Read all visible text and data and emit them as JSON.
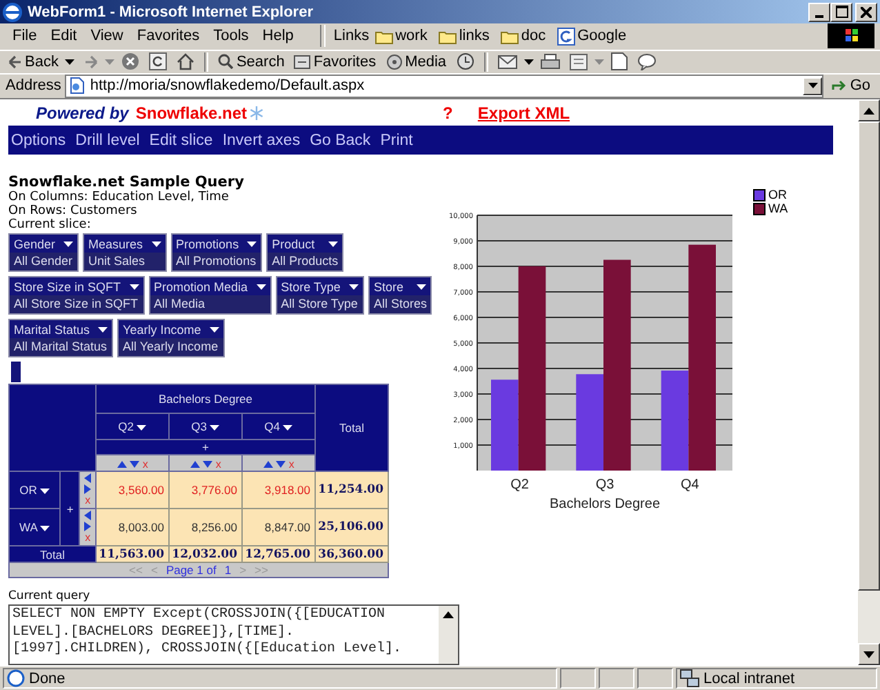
{
  "window": {
    "title": "WebForm1 - Microsoft Internet Explorer"
  },
  "menu": [
    "File",
    "Edit",
    "View",
    "Favorites",
    "Tools",
    "Help"
  ],
  "links": {
    "label": "Links",
    "items": [
      "work",
      "links",
      "doc",
      "Google"
    ]
  },
  "toolbar_labels": [
    "Back",
    "Search",
    "Favorites",
    "Media"
  ],
  "address": {
    "label": "Address",
    "value": "http://moria/snowflakedemo/Default.aspx",
    "go": "Go"
  },
  "brand": {
    "prefix": "Powered by",
    "name": "Snowflake.net"
  },
  "top_links": [
    "?",
    "Export XML"
  ],
  "nav": [
    "Options",
    "Drill level",
    "Edit slice",
    "Invert axes",
    "Go Back",
    "Print"
  ],
  "heading": "Snowflake.net Sample Query",
  "info": [
    "On Columns: Education Level, Time",
    "On Rows: Customers",
    "Current slice:"
  ],
  "slicers": [
    [
      {
        "name": "Gender",
        "value": "All Gender"
      },
      {
        "name": "Measures",
        "value": "Unit Sales"
      },
      {
        "name": "Promotions",
        "value": "All Promotions"
      },
      {
        "name": "Product",
        "value": "All Products"
      }
    ],
    [
      {
        "name": "Store Size in SQFT",
        "value": "All Store Size in SQFT"
      },
      {
        "name": "Promotion Media",
        "value": "All Media"
      },
      {
        "name": "Store Type",
        "value": "All Store Type"
      },
      {
        "name": "Store",
        "value": "All Stores"
      }
    ],
    [
      {
        "name": "Marital Status",
        "value": "All Marital Status"
      },
      {
        "name": "Yearly Income",
        "value": "All Yearly Income"
      }
    ]
  ],
  "pivot": {
    "column_group": "Bachelors Degree",
    "column_total_label": "Total",
    "column_expand": "+",
    "row_expand": "+",
    "row_total_label": "Total",
    "columns": [
      {
        "label": "Q2",
        "remove": "x"
      },
      {
        "label": "Q3",
        "remove": "x"
      },
      {
        "label": "Q4",
        "remove": "x"
      }
    ],
    "rows": [
      {
        "name": "OR",
        "remove": "x",
        "highlighted": true,
        "cells": [
          "3,560.00",
          "3,776.00",
          "3,918.00"
        ],
        "total": "11,254.00"
      },
      {
        "name": "WA",
        "remove": "x",
        "highlighted": false,
        "cells": [
          "8,003.00",
          "8,256.00",
          "8,847.00"
        ],
        "total": "25,106.00"
      }
    ],
    "totals": [
      "11,563.00",
      "12,032.00",
      "12,765.00"
    ],
    "grand_total": "36,360.00",
    "pager": [
      {
        "text": "<<",
        "disabled": true
      },
      {
        "text": "<",
        "disabled": true
      },
      {
        "text": "Page 1 of",
        "disabled": false
      },
      {
        "text": "1",
        "disabled": false
      },
      {
        "text": ">",
        "disabled": true
      },
      {
        "text": ">>",
        "disabled": true
      }
    ]
  },
  "chart": {
    "chart_data": {
      "type": "bar",
      "grid": true,
      "xlabel": "Bachelors Degree",
      "categories": [
        "Q2",
        "Q3",
        "Q4"
      ],
      "series": [
        {
          "name": "OR",
          "color": "#6a3ae0",
          "values": [
            3560,
            3776,
            3918
          ]
        },
        {
          "name": "WA",
          "color": "#7a1038",
          "values": [
            8003,
            8256,
            8847
          ]
        }
      ],
      "ylim": [
        0,
        10000
      ],
      "yticks": [
        {
          "value": 1000,
          "label": "1,000"
        },
        {
          "value": 2000,
          "label": "2,000"
        },
        {
          "value": 3000,
          "label": "3,000"
        },
        {
          "value": 4000,
          "label": "4,000"
        },
        {
          "value": 5000,
          "label": "5,000"
        },
        {
          "value": 6000,
          "label": "6,000"
        },
        {
          "value": 7000,
          "label": "7,000"
        },
        {
          "value": 8000,
          "label": "8,000"
        },
        {
          "value": 9000,
          "label": "9,000"
        },
        {
          "value": 10000,
          "label": "10,000"
        }
      ]
    }
  },
  "query": {
    "label": "Current query",
    "lines": [
      "SELECT NON EMPTY Except(CROSSJOIN({[EDUCATION",
      "LEVEL].[BACHELORS DEGREE]},[TIME].",
      "[1997].CHILDREN), CROSSJOIN({[Education Level]."
    ]
  },
  "status": {
    "text": "Done",
    "zone": "Local intranet"
  }
}
